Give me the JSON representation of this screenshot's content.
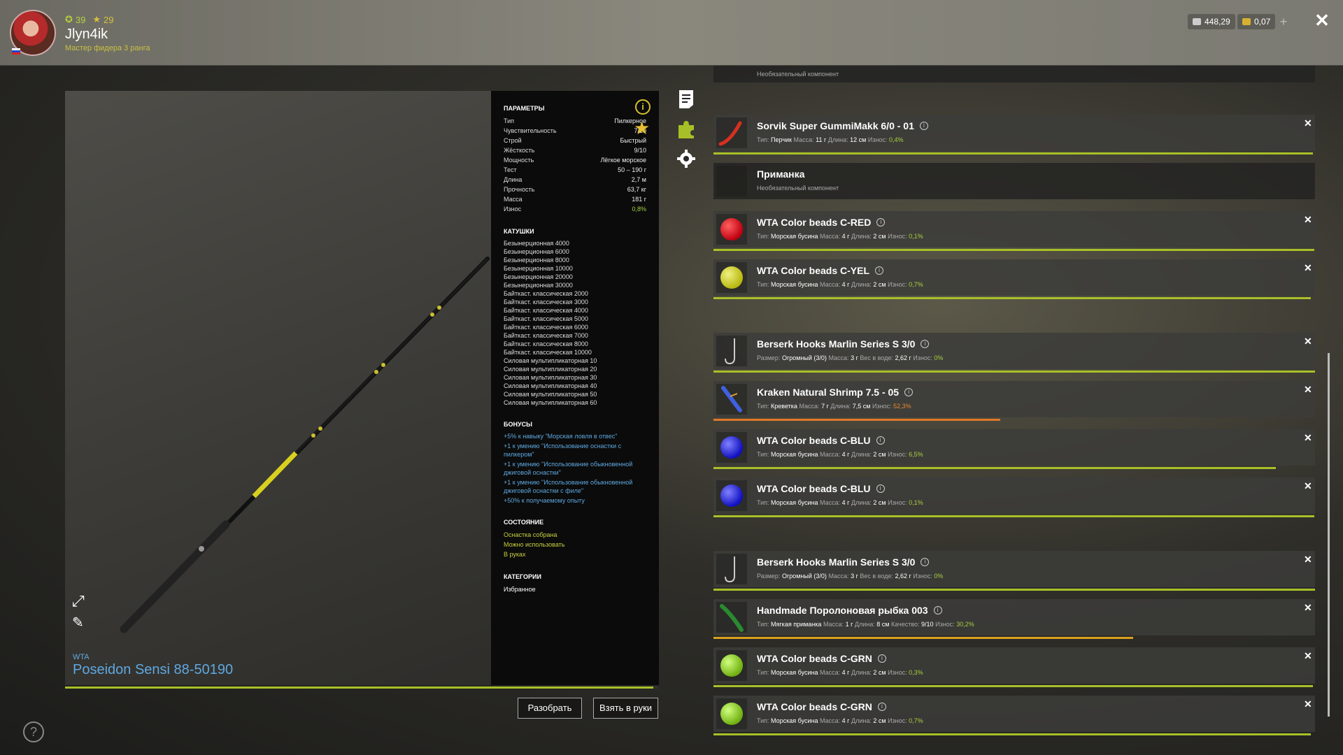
{
  "player": {
    "level": "39",
    "stars": "29",
    "name": "Jlyn4ik",
    "rank": "Мастер фидера 3 ранга"
  },
  "currency": {
    "silver": "448,29",
    "gold": "0,07",
    "plus": "+"
  },
  "rod": {
    "brand": "WTA",
    "name": "Poseidon Sensi 88-50190",
    "wear_fraction": 0.992
  },
  "params": {
    "title": "ПАРАМЕТРЫ",
    "rows": [
      {
        "k": "Тип",
        "v": "Пилкерное"
      },
      {
        "k": "Чувствительность",
        "v": "7/10"
      },
      {
        "k": "Строй",
        "v": "Быстрый"
      },
      {
        "k": "Жёсткость",
        "v": "9/10"
      },
      {
        "k": "Мощность",
        "v": "Лёгкое морское"
      },
      {
        "k": "Тест",
        "v": "50 – 190 г"
      },
      {
        "k": "Длина",
        "v": "2,7 м"
      },
      {
        "k": "Прочность",
        "v": "63,7 кг"
      },
      {
        "k": "Масса",
        "v": "181 г"
      },
      {
        "k": "Износ",
        "v": "0,8%"
      }
    ],
    "reels_title": "КАТУШКИ",
    "reels": [
      "Безынерционная 4000",
      "Безынерционная 6000",
      "Безынерционная 8000",
      "Безынерционная 10000",
      "Безынерционная 20000",
      "Безынерционная 30000",
      "Байткаст. классическая 2000",
      "Байткаст. классическая 3000",
      "Байткаст. классическая 4000",
      "Байткаст. классическая 5000",
      "Байткаст. классическая 6000",
      "Байткаст. классическая 7000",
      "Байткаст. классическая 8000",
      "Байткаст. классическая 10000",
      "Силовая мультипликаторная 10",
      "Силовая мультипликаторная 20",
      "Силовая мультипликаторная 30",
      "Силовая мультипликаторная 40",
      "Силовая мультипликаторная 50",
      "Силовая мультипликаторная 60"
    ],
    "bonuses_title": "БОНУСЫ",
    "bonuses": [
      "+5% к навыку \"Морская ловля в отвес\"",
      "+1 к умению \"Использование оснастки с пилкером\"",
      "+1 к умению \"Использование обыкновенной джиговой оснастки\"",
      "+1 к умению \"Использование обыкновенной джиговой оснастки с филе\"",
      "+50% к получаемому опыту"
    ],
    "state_title": "СОСТОЯНИЕ",
    "state": [
      "Оснастка собрана",
      "Можно использовать",
      "В руках"
    ],
    "categories_title": "КАТЕГОРИИ",
    "categories": [
      "Избранное"
    ]
  },
  "buttons": {
    "disassemble": "Разобрать",
    "take": "Взять в руки"
  },
  "help": "?",
  "top_partial": {
    "sub": "Необязательный компонент"
  },
  "items": [
    {
      "title": "Sorvik Super GummiMakk 6/0 - 01",
      "l1": "Тип:",
      "v1": "Перчик",
      "l2": "Масса:",
      "v2": "11 г",
      "l3": "Длина:",
      "v3": "12 см",
      "l4": "Износ:",
      "v4": "0,4%",
      "wear": 0.996,
      "color": "#a8c028"
    },
    {
      "title": "Приманка",
      "sub": "Необязательный компонент"
    },
    {
      "title": "WTA Color beads C-RED",
      "l1": "Тип:",
      "v1": "Морская бусина",
      "l2": "Масса:",
      "v2": "4 г",
      "l3": "Длина:",
      "v3": "2 см",
      "l4": "Износ:",
      "v4": "0,1%",
      "wear": 0.999,
      "color": "#a8c028"
    },
    {
      "title": "WTA Color beads C-YEL",
      "l1": "Тип:",
      "v1": "Морская бусина",
      "l2": "Масса:",
      "v2": "4 г",
      "l3": "Длина:",
      "v3": "2 см",
      "l4": "Износ:",
      "v4": "0,7%",
      "wear": 0.993,
      "color": "#a8c028"
    },
    {
      "title": "Berserk Hooks Marlin Series S 3/0",
      "l1": "Размер:",
      "v1": "Огромный (3/0)",
      "l2": "Масса:",
      "v2": "3 г",
      "l3": "Вес в воде:",
      "v3": "2,62 г",
      "l4": "Износ:",
      "v4": "0%",
      "wear": 1.0,
      "color": "#a8c028"
    },
    {
      "title": "Kraken Natural Shrimp 7.5 - 05",
      "l1": "Тип:",
      "v1": "Креветка",
      "l2": "Масса:",
      "v2": "7 г",
      "l3": "Длина:",
      "v3": "7,5 см",
      "l4": "Износ:",
      "v4": "52,3%",
      "wear": 0.477,
      "color": "#e0782a"
    },
    {
      "title": "WTA Color beads C-BLU",
      "l1": "Тип:",
      "v1": "Морская бусина",
      "l2": "Масса:",
      "v2": "4 г",
      "l3": "Длина:",
      "v3": "2 см",
      "l4": "Износ:",
      "v4": "6,5%",
      "wear": 0.935,
      "color": "#a8c028"
    },
    {
      "title": "WTA Color beads C-BLU",
      "l1": "Тип:",
      "v1": "Морская бусина",
      "l2": "Масса:",
      "v2": "4 г",
      "l3": "Длина:",
      "v3": "2 см",
      "l4": "Износ:",
      "v4": "0,1%",
      "wear": 0.999,
      "color": "#a8c028"
    },
    {
      "title": "Berserk Hooks Marlin Series S 3/0",
      "l1": "Размер:",
      "v1": "Огромный (3/0)",
      "l2": "Масса:",
      "v2": "3 г",
      "l3": "Вес в воде:",
      "v3": "2,62 г",
      "l4": "Износ:",
      "v4": "0%",
      "wear": 1.0,
      "color": "#a8c028"
    },
    {
      "title": "Handmade Поролоновая рыбка 003",
      "l1": "Тип:",
      "v1": "Мягкая приманка",
      "l2": "Масса:",
      "v2": "1 г",
      "l3": "Длина:",
      "v3": "8 см",
      "l4": "Качество:",
      "v4": "9/10",
      "l5": "Износ:",
      "v5": "30,2%",
      "wear": 0.698,
      "color": "#d8a020"
    },
    {
      "title": "WTA Color beads C-GRN",
      "l1": "Тип:",
      "v1": "Морская бусина",
      "l2": "Масса:",
      "v2": "4 г",
      "l3": "Длина:",
      "v3": "2 см",
      "l4": "Износ:",
      "v4": "0,3%",
      "wear": 0.997,
      "color": "#a8c028"
    },
    {
      "title": "WTA Color beads C-GRN",
      "l1": "Тип:",
      "v1": "Морская бусина",
      "l2": "Масса:",
      "v2": "4 г",
      "l3": "Длина:",
      "v3": "2 см",
      "l4": "Износ:",
      "v4": "0,7%",
      "wear": 0.993,
      "color": "#a8c028"
    }
  ]
}
